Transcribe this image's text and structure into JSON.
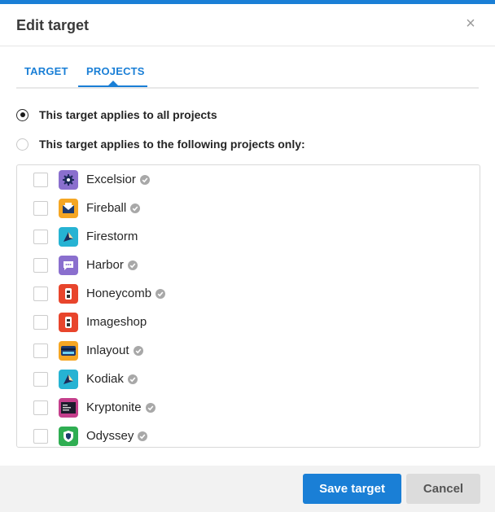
{
  "dialog": {
    "title": "Edit target",
    "close_glyph": "×"
  },
  "tabs": [
    {
      "label": "TARGET",
      "active": false
    },
    {
      "label": "PROJECTS",
      "active": true
    }
  ],
  "scope": {
    "all_projects_label": "This target applies to all projects",
    "selected_projects_label": "This target applies to the following projects only:",
    "selected": "all"
  },
  "projects": [
    {
      "name": "Excelsior",
      "verified": true,
      "icon": "gear-icon",
      "icon_bg": "#8a6fce",
      "checked": false
    },
    {
      "name": "Fireball",
      "verified": true,
      "icon": "envelope-icon",
      "icon_bg": "#f5a623",
      "checked": false
    },
    {
      "name": "Firestorm",
      "verified": false,
      "icon": "kite-icon",
      "icon_bg": "#26b3d3",
      "checked": false
    },
    {
      "name": "Harbor",
      "verified": true,
      "icon": "chat-icon",
      "icon_bg": "#8a6fce",
      "checked": false
    },
    {
      "name": "Honeycomb",
      "verified": true,
      "icon": "robot-icon",
      "icon_bg": "#e8452c",
      "checked": false
    },
    {
      "name": "Imageshop",
      "verified": false,
      "icon": "robot-icon",
      "icon_bg": "#e8452c",
      "checked": false
    },
    {
      "name": "Inlayout",
      "verified": true,
      "icon": "credit-card-icon",
      "icon_bg": "#f5a623",
      "checked": false
    },
    {
      "name": "Kodiak",
      "verified": true,
      "icon": "kite-icon",
      "icon_bg": "#26b3d3",
      "checked": false
    },
    {
      "name": "Kryptonite",
      "verified": true,
      "icon": "terminal-icon",
      "icon_bg": "#c43f8c",
      "checked": false
    },
    {
      "name": "Odyssey",
      "verified": true,
      "icon": "shield-icon",
      "icon_bg": "#2fae52",
      "checked": false
    }
  ],
  "footer": {
    "save_label": "Save target",
    "cancel_label": "Cancel"
  },
  "colors": {
    "accent": "#1a7fd6",
    "footer_bg": "#f2f2f2",
    "verified_badge": "#a8a8a8"
  }
}
